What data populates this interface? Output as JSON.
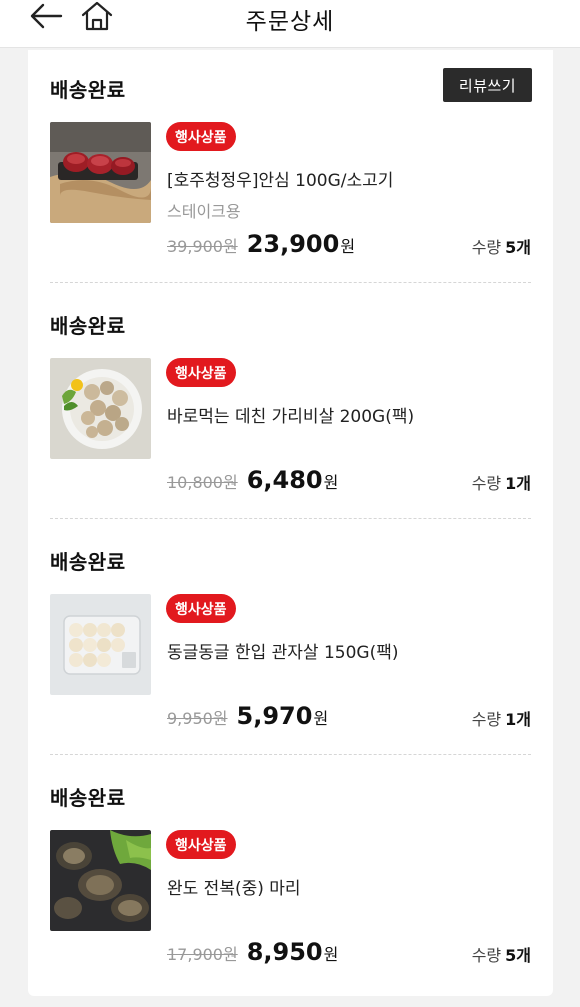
{
  "header": {
    "title": "주문상세"
  },
  "review_label": "리뷰쓰기",
  "currency_unit": "원",
  "qty_label": "수량",
  "items": [
    {
      "status": "배송완료",
      "badge": "행사상품",
      "name": "[호주청정우]안심 100G/소고기",
      "sub": "스테이크용",
      "original_price": "39,900원",
      "price": "23,900",
      "qty": "5개"
    },
    {
      "status": "배송완료",
      "badge": "행사상품",
      "name": "바로먹는 데친 가리비살 200G(팩)",
      "sub": "",
      "original_price": "10,800원",
      "price": "6,480",
      "qty": "1개"
    },
    {
      "status": "배송완료",
      "badge": "행사상품",
      "name": "동글동글 한입 관자살 150G(팩)",
      "sub": "",
      "original_price": "9,950원",
      "price": "5,970",
      "qty": "1개"
    },
    {
      "status": "배송완료",
      "badge": "행사상품",
      "name": "완도 전복(중) 마리",
      "sub": "",
      "original_price": "17,900원",
      "price": "8,950",
      "qty": "5개"
    }
  ],
  "colors": {
    "badge": "#e2191e",
    "review_button": "#2b2b2b",
    "background": "#f2f2f2"
  }
}
